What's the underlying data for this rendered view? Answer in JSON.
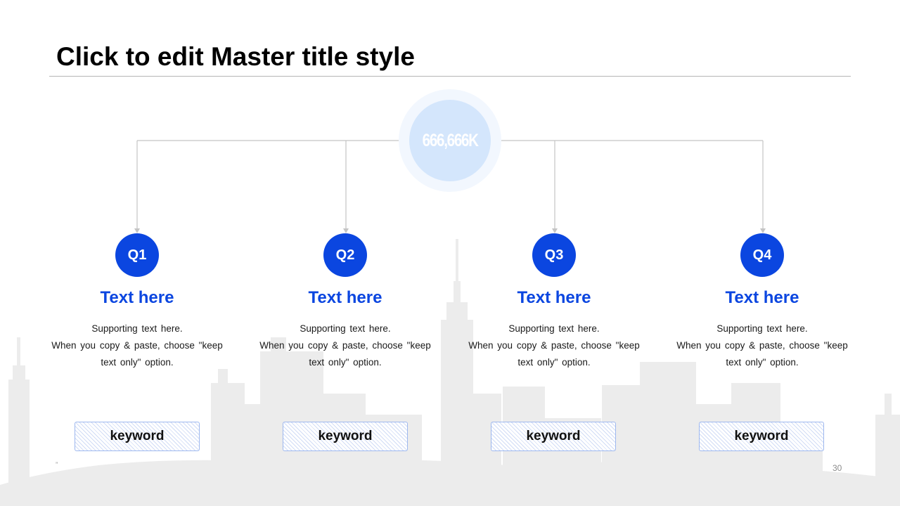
{
  "slide": {
    "title": "Click to edit Master title style",
    "hub_value": "666,666K",
    "page_number": "30",
    "footer_left": "ˮ"
  },
  "columns": [
    {
      "badge": "Q1",
      "heading": "Text here",
      "body": "Supporting  text here.\nWhen  you copy & paste, choose \"keep\ntext only\" option.",
      "keyword": "keyword"
    },
    {
      "badge": "Q2",
      "heading": "Text here",
      "body": "Supporting  text here.\nWhen  you copy & paste, choose \"keep\ntext only\" option.",
      "keyword": "keyword"
    },
    {
      "badge": "Q3",
      "heading": "Text here",
      "body": "Supporting  text here.\nWhen  you copy & paste, choose \"keep\ntext only\" option.",
      "keyword": "keyword"
    },
    {
      "badge": "Q4",
      "heading": "Text here",
      "body": "Supporting  text here.\nWhen  you copy & paste, choose \"keep\ntext only\" option.",
      "keyword": "keyword"
    }
  ],
  "colors": {
    "accent": "#0b46e0",
    "hub_fill": "#d4e6fc",
    "hub_ring": "#f2f7fe",
    "skyline": "#e9e9e9",
    "connector": "#c4c4c4",
    "keyword_border": "#9eb8ef"
  }
}
